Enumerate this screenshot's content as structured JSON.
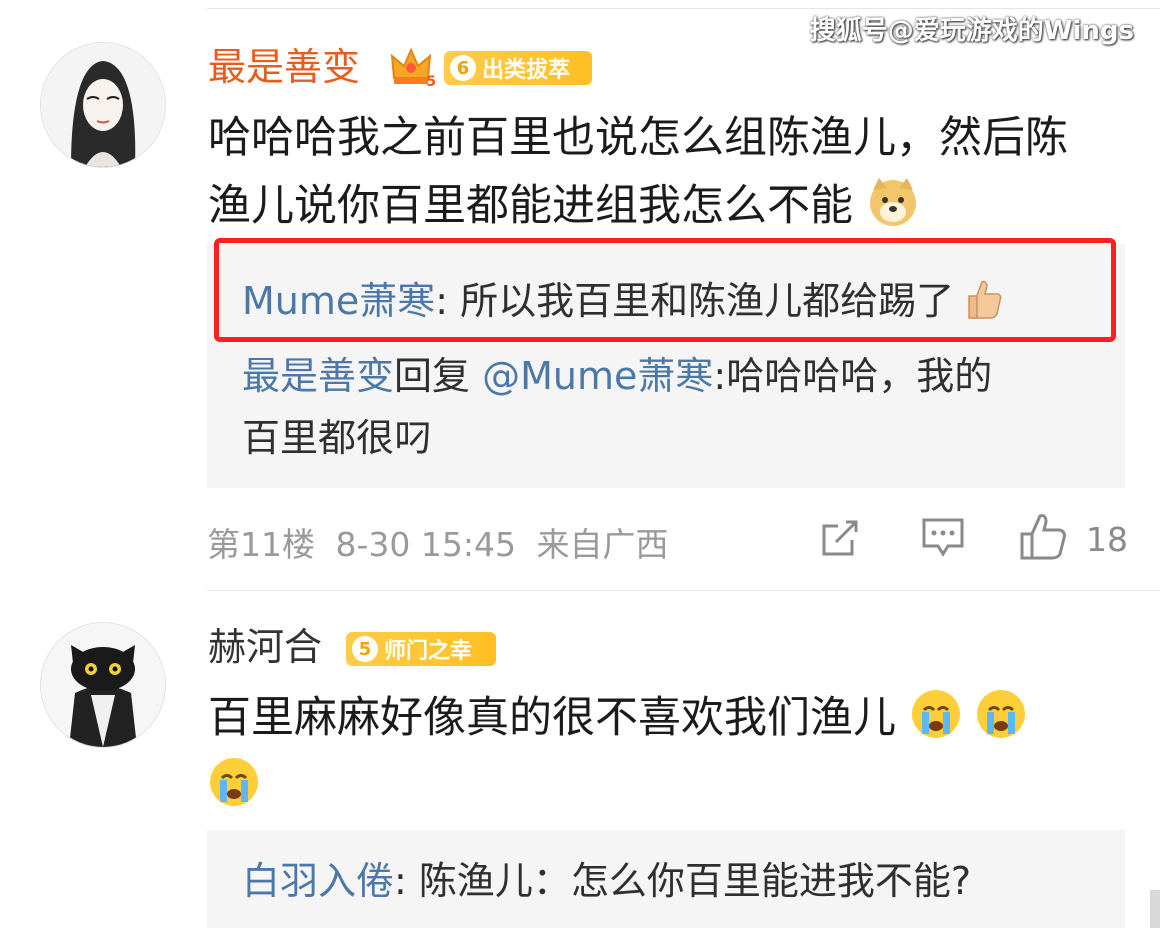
{
  "watermark": "搜狐号@爱玩游戏的Wings",
  "comments": [
    {
      "username": "最是善变",
      "username_color": "#e85d1c",
      "level_badge": "5",
      "fan_badge": {
        "level": "6",
        "title": "出类拔萃"
      },
      "text_line1": "哈哈哈我之前百里也说怎么组陈渔儿，然后陈",
      "text_line2": "渔儿说你百里都能进组我怎么不能",
      "text_emoji": "doge-emoji",
      "replies": [
        {
          "author": "Mume萧寒",
          "separator": ": ",
          "text": "所以我百里和陈渔儿都给踢了",
          "emoji": "thumbs-up-emoji"
        },
        {
          "author": "最是善变",
          "action": "回复",
          "mention": "@Mume萧寒",
          "text_line1": ":哈哈哈哈，我的",
          "text_line2": "百里都很叼"
        }
      ],
      "meta": {
        "floor": "第11楼",
        "datetime": "8-30 15:45",
        "location": "来自广西"
      },
      "like_count": "18"
    },
    {
      "username": "赫河合",
      "username_color": "#333333",
      "fan_badge": {
        "level": "5",
        "title": "师门之幸"
      },
      "text_line1": "百里麻麻好像真的很不喜欢我们渔儿",
      "text_emoji": "crying-emoji",
      "replies": [
        {
          "author": "白羽入倦",
          "separator": ": ",
          "text": "陈渔儿：怎么你百里能进我不能?"
        }
      ]
    }
  ],
  "colors": {
    "link": "#4c78a8",
    "highlight": "#ff1f1f",
    "badge": "#ffc233"
  }
}
